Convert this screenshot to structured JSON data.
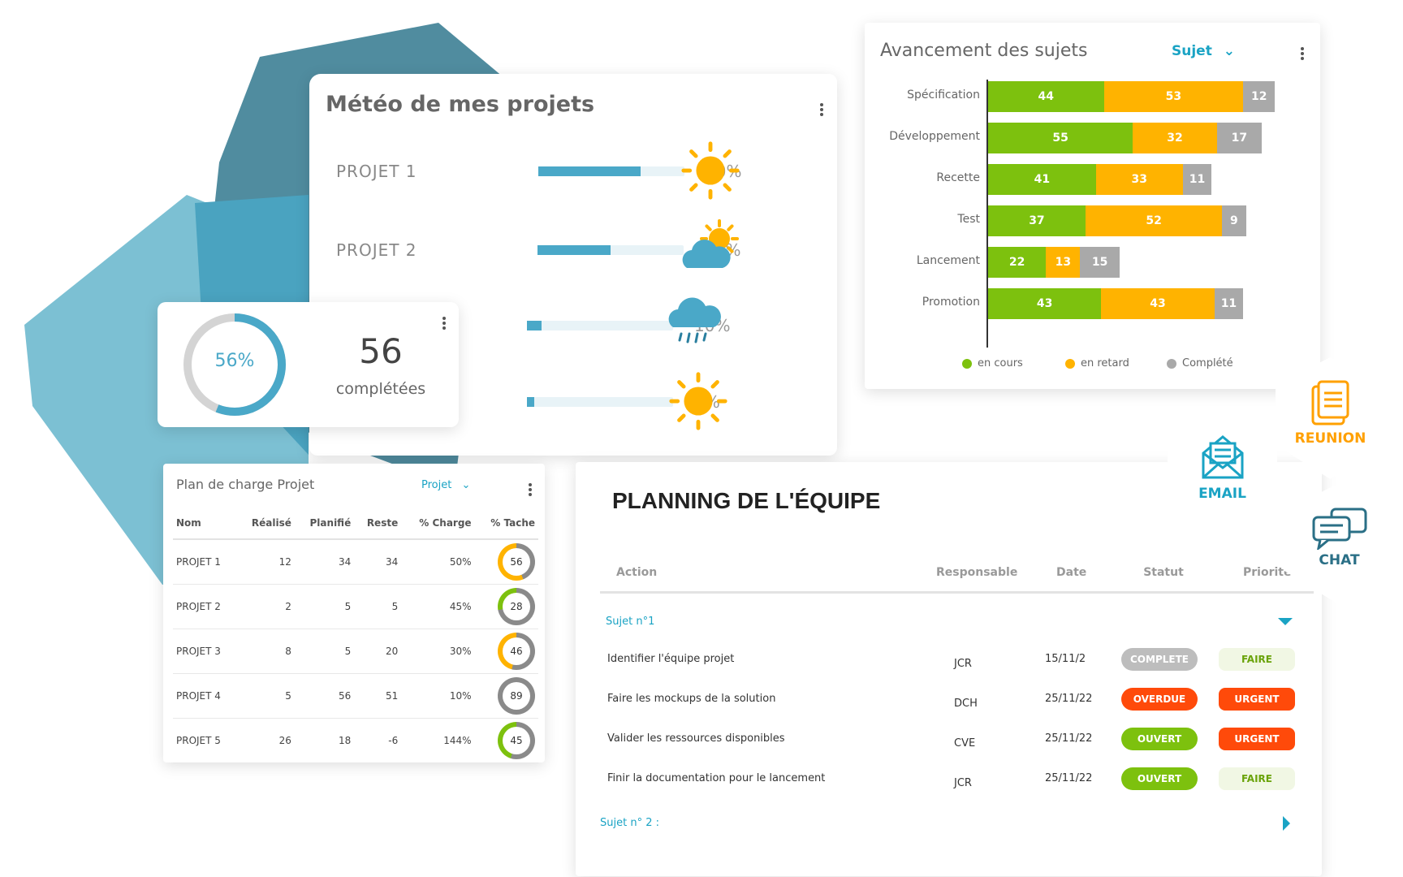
{
  "colors": {
    "accent": "#1aa3c4",
    "green": "#7dc10e",
    "orange": "#ffb300",
    "grey": "#a9a9a9",
    "red": "#ff4a0a",
    "teal_dark": "#3d7f95",
    "teal_light": "#7cc0d3"
  },
  "meteo": {
    "title": "Météo de mes projets",
    "rows": [
      {
        "label": "PROJET 1",
        "percent": 70,
        "pct_text": "70%",
        "icon": "sun-icon"
      },
      {
        "label": "PROJET 2",
        "percent": 50,
        "pct_text": "50%",
        "icon": "sun-cloud-icon"
      },
      {
        "label": "",
        "percent": 10,
        "pct_text": "10%",
        "icon": "rain-cloud-icon"
      },
      {
        "label": "",
        "percent": 5,
        "pct_text": "5%",
        "icon": "sun-icon"
      }
    ]
  },
  "completion": {
    "percent": 56,
    "percent_text": "56%",
    "count": "56",
    "label": "complétées"
  },
  "plan": {
    "title": "Plan de charge Projet",
    "filter": "Projet",
    "columns": [
      "Nom",
      "Réalisé",
      "Planifié",
      "Reste",
      "% Charge",
      "% Tache"
    ],
    "rows": [
      {
        "nom": "PROJET 1",
        "realise": "12",
        "planifie": "34",
        "reste": "34",
        "charge": "50%",
        "tache": "56",
        "ring": "orange"
      },
      {
        "nom": "PROJET 2",
        "realise": "2",
        "planifie": "5",
        "reste": "5",
        "charge": "45%",
        "tache": "28",
        "ring": "green"
      },
      {
        "nom": "PROJET 3",
        "realise": "8",
        "planifie": "5",
        "reste": "20",
        "charge": "30%",
        "tache": "46",
        "ring": "orange"
      },
      {
        "nom": "PROJET 4",
        "realise": "5",
        "planifie": "56",
        "reste": "51",
        "charge": "10%",
        "tache": "89",
        "ring": "grey"
      },
      {
        "nom": "PROJET 5",
        "realise": "26",
        "planifie": "18",
        "reste": "-6",
        "charge": "144%",
        "tache": "45",
        "ring": "green"
      }
    ]
  },
  "chart_data": {
    "type": "bar",
    "orientation": "horizontal-stacked",
    "title": "Avancement des sujets",
    "filter": "Sujet",
    "categories": [
      "Spécification",
      "Développement",
      "Recette",
      "Test",
      "Lancement",
      "Promotion"
    ],
    "series": [
      {
        "name": "en cours",
        "color": "#7dc10e",
        "values": [
          44,
          55,
          41,
          37,
          22,
          43
        ]
      },
      {
        "name": "en retard",
        "color": "#ffb300",
        "values": [
          53,
          32,
          33,
          52,
          13,
          43
        ]
      },
      {
        "name": "Complété",
        "color": "#a9a9a9",
        "values": [
          12,
          17,
          11,
          9,
          15,
          11
        ]
      }
    ],
    "legend": "bottom",
    "grid": false
  },
  "planning": {
    "title": "PLANNING DE L'ÉQUIPE",
    "columns": [
      "Action",
      "Responsable",
      "Date",
      "Statut",
      "Priorité"
    ],
    "group1": "Sujet  n°1",
    "group2": "Sujet  n° 2 :",
    "rows": [
      {
        "action": "Identifier l'équipe projet",
        "resp": "JCR",
        "date": "15/11/2",
        "statut": "COMPLETE",
        "statut_color": "#bdbdbd",
        "prio": "FAIRE",
        "prio_kind": "light"
      },
      {
        "action": "Faire les mockups de la solution",
        "resp": "DCH",
        "date": "25/11/22",
        "statut": "OVERDUE",
        "statut_color": "#ff4a0a",
        "prio": "URGENT",
        "prio_kind": "red"
      },
      {
        "action": "Valider les ressources disponibles",
        "resp": "CVE",
        "date": "25/11/22",
        "statut": "OUVERT",
        "statut_color": "#7dc10e",
        "prio": "URGENT",
        "prio_kind": "red"
      },
      {
        "action": "Finir la documentation pour le lancement",
        "resp": "JCR",
        "date": "25/11/22",
        "statut": "OUVERT",
        "statut_color": "#7dc10e",
        "prio": "FAIRE",
        "prio_kind": "light"
      }
    ]
  },
  "badges": {
    "reunion": "REUNION",
    "email": "EMAIL",
    "chat": "CHAT"
  }
}
